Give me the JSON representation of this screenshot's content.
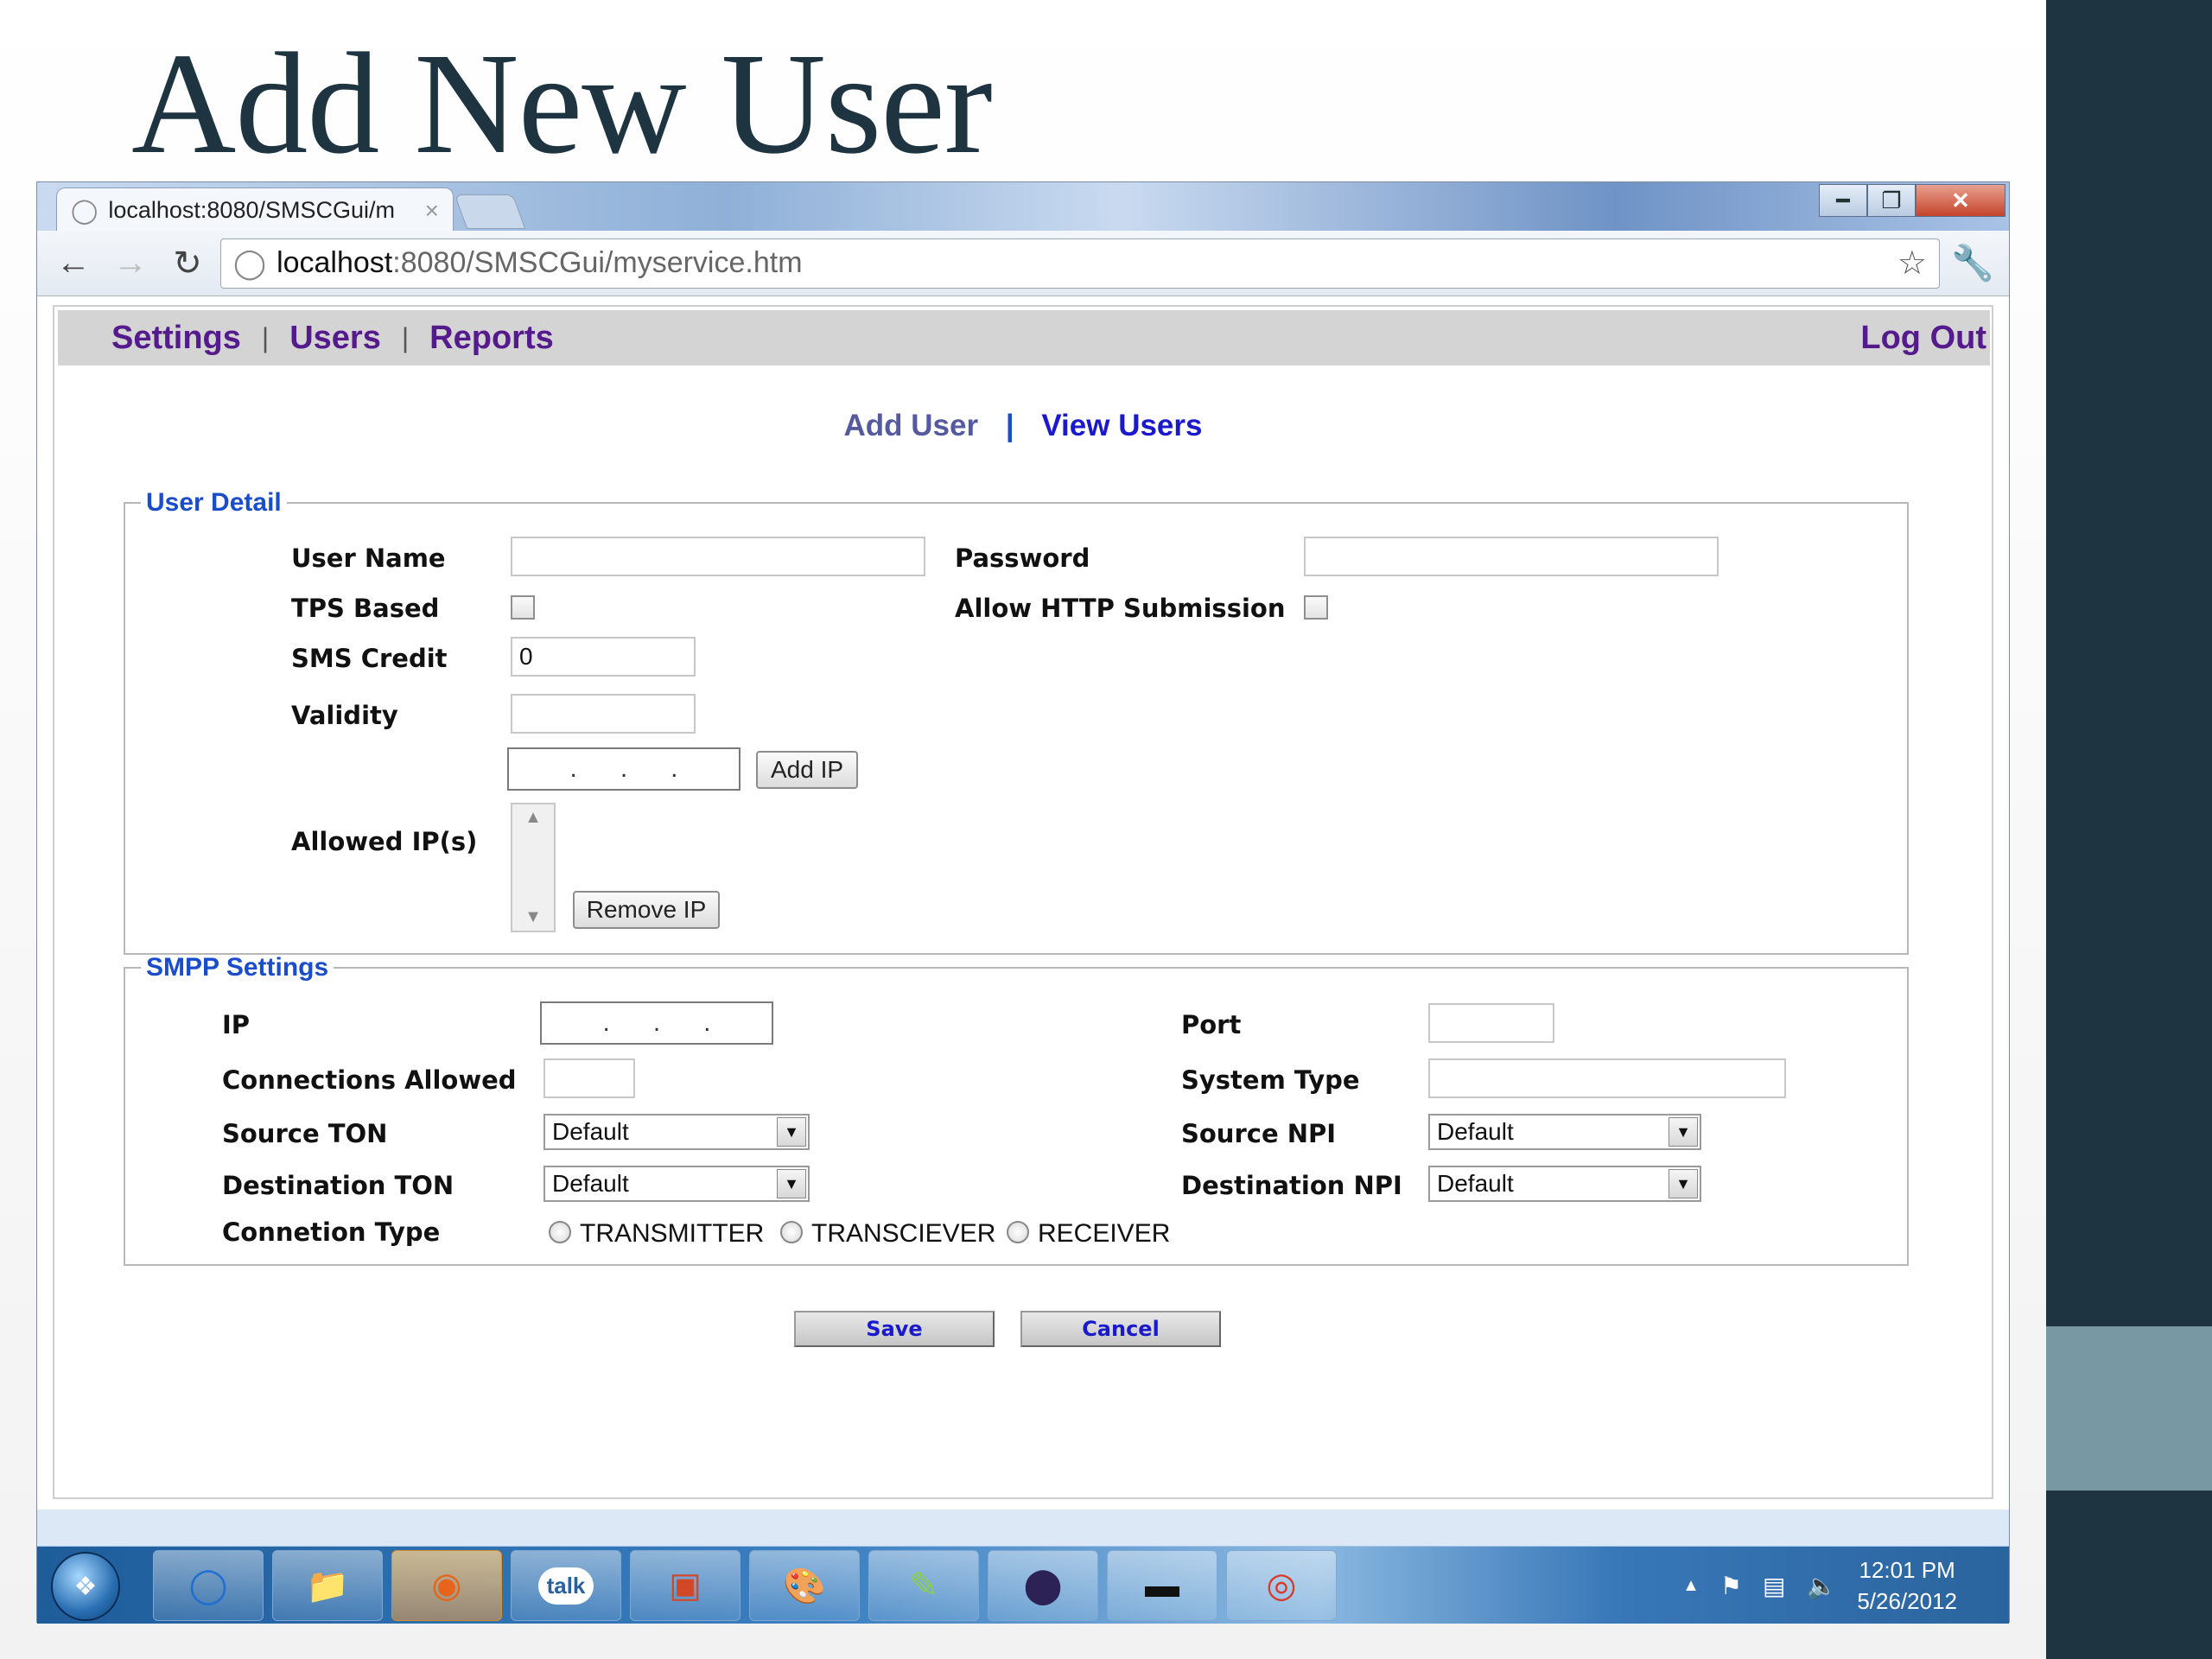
{
  "slide": {
    "title": "Add New User"
  },
  "browser": {
    "tab_title": "localhost:8080/SMSCGui/m",
    "url_host": "localhost",
    "url_rest": ":8080/SMSCGui/myservice.htm"
  },
  "menu": {
    "settings": "Settings",
    "users": "Users",
    "reports": "Reports",
    "logout": "Log Out",
    "sep": "|"
  },
  "subnav": {
    "add_user": "Add User",
    "view_users": "View Users",
    "sep": "|"
  },
  "user_detail": {
    "legend": "User Detail",
    "user_name_label": "User Name",
    "password_label": "Password",
    "tps_label": "TPS Based",
    "allow_http_label": "Allow HTTP Submission",
    "sms_credit_label": "SMS Credit",
    "sms_credit_value": "0",
    "validity_label": "Validity",
    "add_ip_button": "Add IP",
    "allowed_ips_label": "Allowed IP(s)",
    "remove_ip_button": "Remove IP",
    "ip_dots": ".      .      ."
  },
  "smpp": {
    "legend": "SMPP Settings",
    "ip_label": "IP",
    "port_label": "Port",
    "connections_label": "Connections Allowed",
    "system_type_label": "System Type",
    "source_ton_label": "Source TON",
    "source_ton_value": "Default",
    "source_npi_label": "Source NPI",
    "source_npi_value": "Default",
    "dest_ton_label": "Destination TON",
    "dest_ton_value": "Default",
    "dest_npi_label": "Destination NPI",
    "dest_npi_value": "Default",
    "conn_type_label": "Connetion Type",
    "radio_transmitter": "TRANSMITTER",
    "radio_transciever": "TRANSCIEVER",
    "radio_receiver": "RECEIVER"
  },
  "actions": {
    "save": "Save",
    "cancel": "Cancel"
  },
  "taskbar": {
    "icons": [
      "start-orb",
      "internet-explorer-icon",
      "file-explorer-icon",
      "firefox-icon",
      "google-talk-icon",
      "powerpoint-icon",
      "paint-icon",
      "notepad-plus-icon",
      "eclipse-icon",
      "command-prompt-icon",
      "chrome-icon"
    ],
    "talk_label": "talk",
    "time": "12:01 PM",
    "date": "5/26/2012"
  },
  "colors": {
    "accent_dark": "#1e3440",
    "link_visited": "#551a8b",
    "link": "#1a1acc",
    "legend": "#1a4dcc"
  }
}
